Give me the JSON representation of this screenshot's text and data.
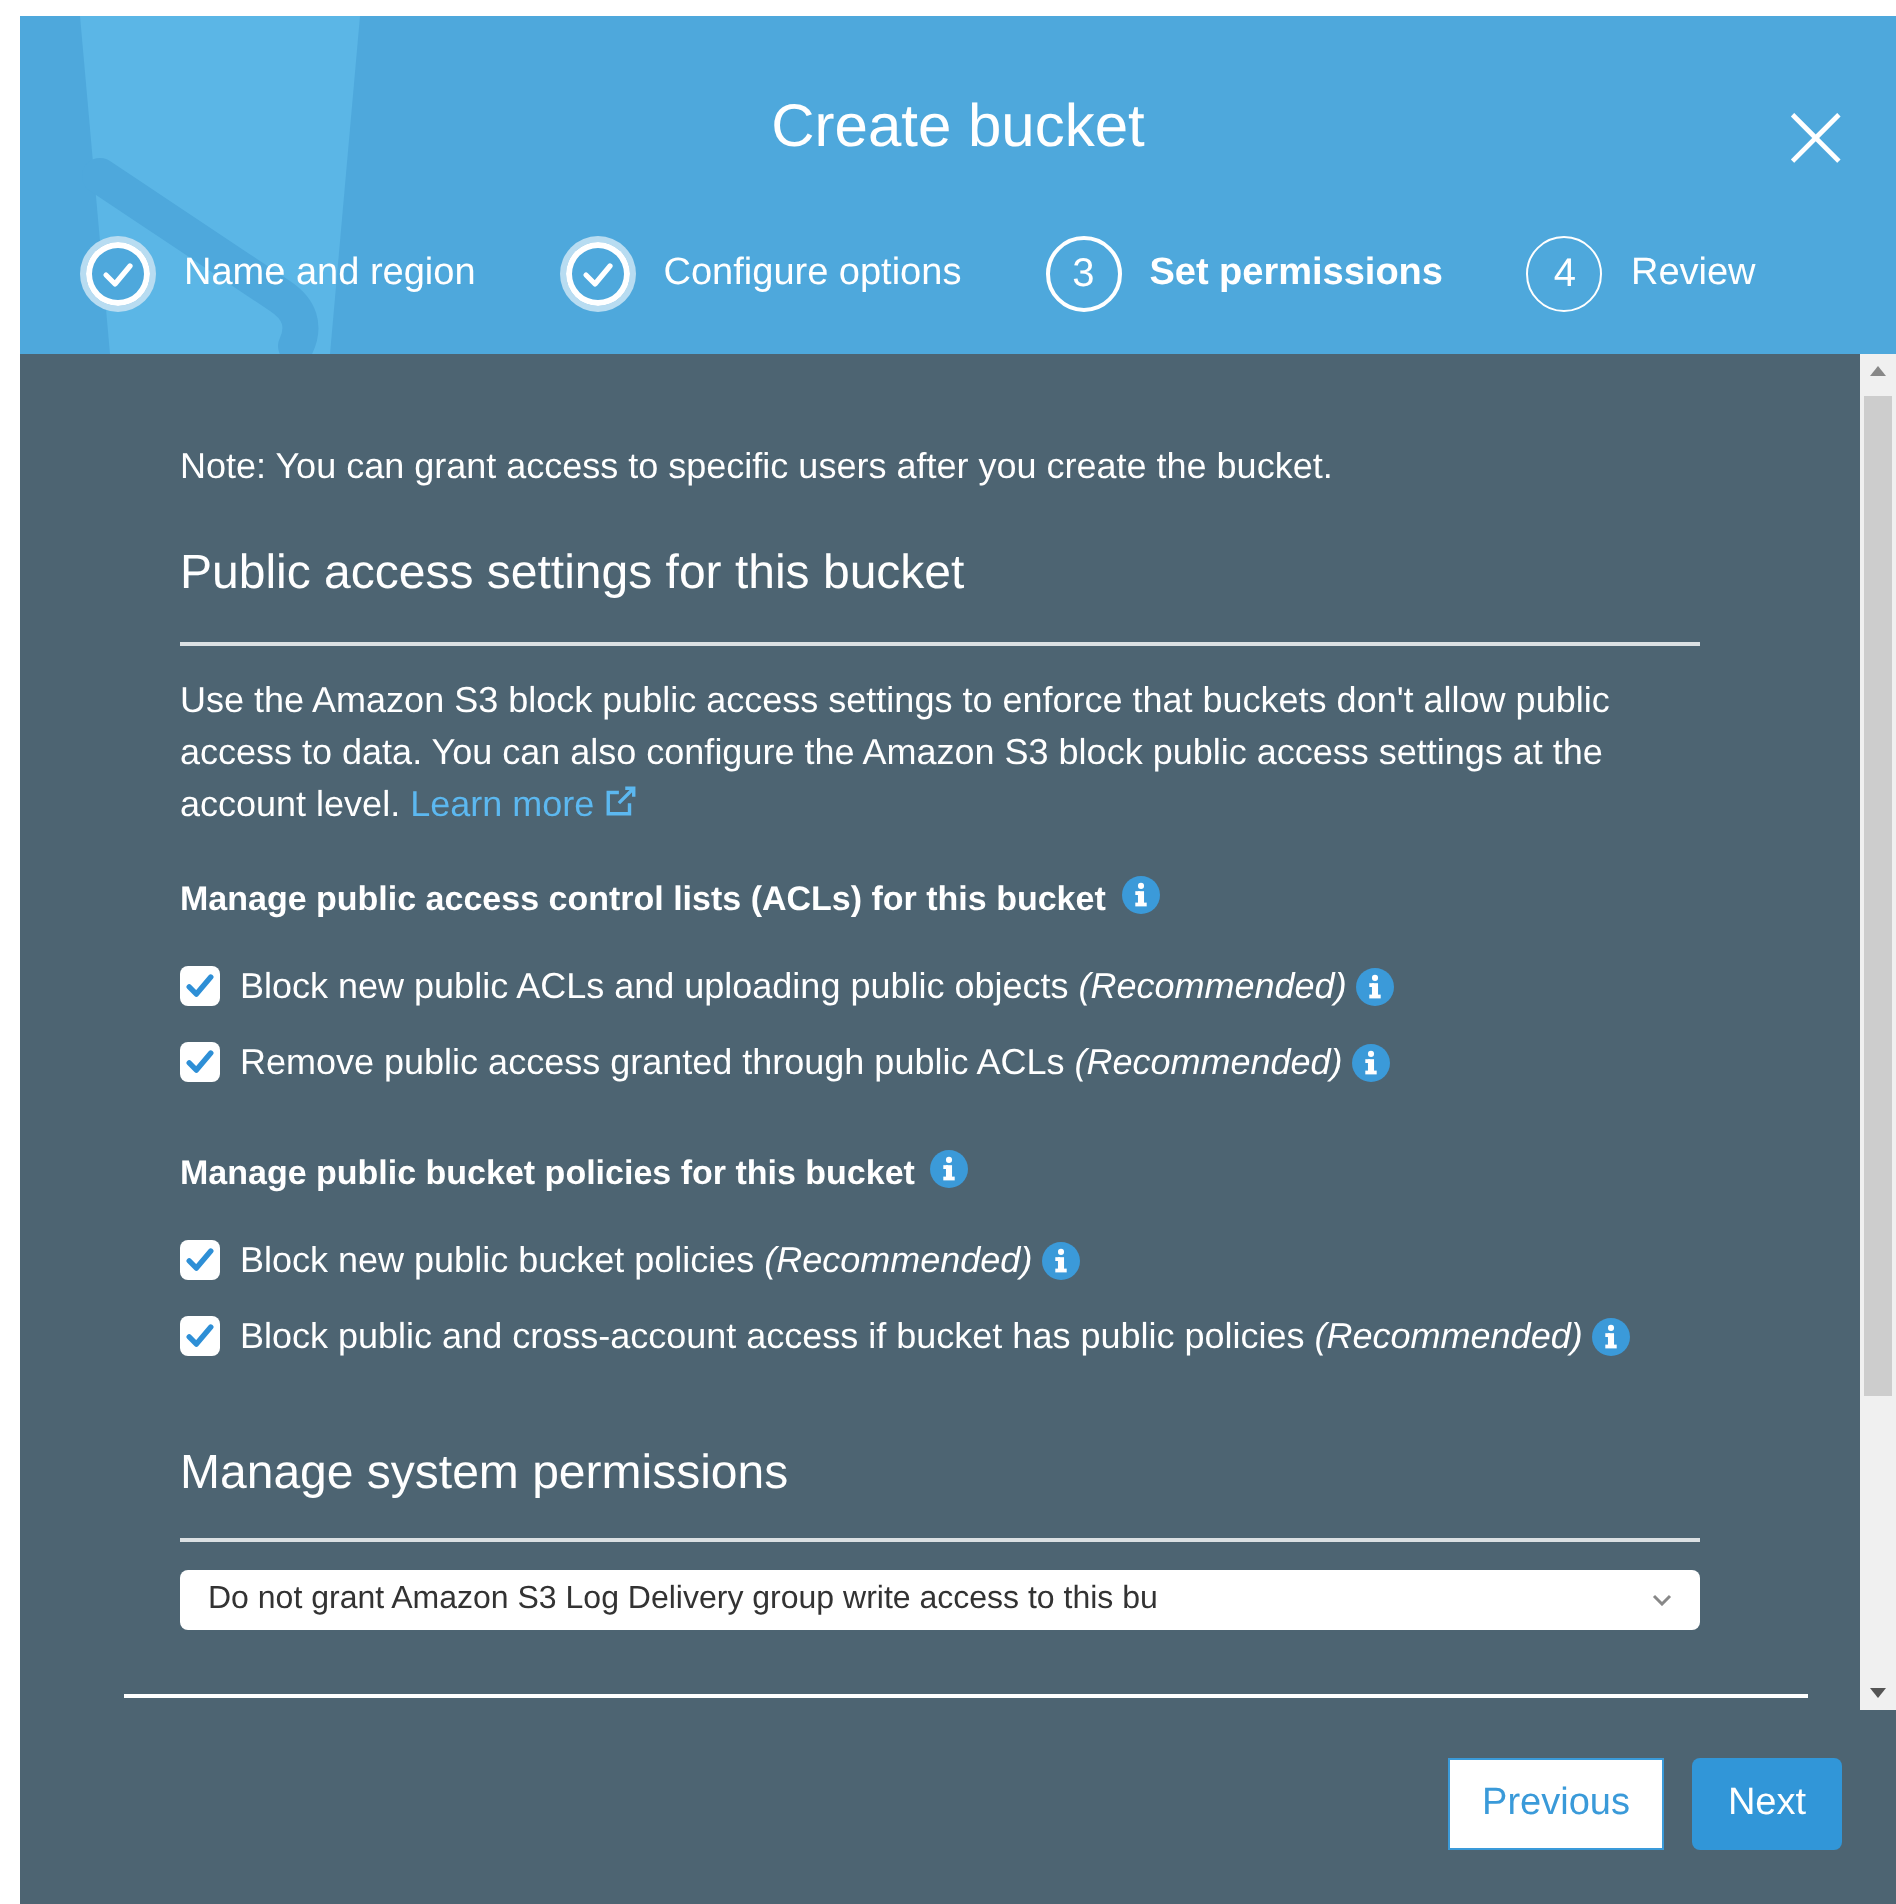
{
  "dialog": {
    "title": "Create bucket",
    "close": "×"
  },
  "steps": [
    {
      "label": "Name and region",
      "completed": true,
      "selected": false
    },
    {
      "label": "Configure options",
      "completed": true,
      "selected": false
    },
    {
      "label": "Set permissions",
      "number": "3",
      "completed": false,
      "selected": true
    },
    {
      "label": "Review",
      "number": "4",
      "completed": false,
      "selected": false
    }
  ],
  "note": "Note: You can grant access to specific users after you create the bucket.",
  "public_access": {
    "heading": "Public access settings for this bucket",
    "description": "Use the Amazon S3 block public access settings to enforce that buckets don't allow public access to data. You can also configure the Amazon S3 block public access settings at the account level.",
    "link": "Learn more",
    "groups": [
      {
        "title": "Manage public access control lists (ACLs) for this bucket",
        "options": [
          {
            "label": "Block new public ACLs and uploading public objects *(Recommended)*",
            "checked": true
          },
          {
            "label": "Remove public access granted through public ACLs *(Recommended)*",
            "checked": true
          }
        ]
      },
      {
        "title": "Manage public bucket policies for this bucket",
        "options": [
          {
            "label": "Block new public bucket policies *(Recommended)*",
            "checked": true
          },
          {
            "label": "Block public and cross-account access if bucket has public policies *(Recommended)*",
            "checked": true
          }
        ]
      }
    ]
  },
  "system_permissions": {
    "heading": "Manage system permissions",
    "dropdown": "Do not grant Amazon S3 Log Delivery group write access to this bu"
  },
  "buttons": {
    "previous": "Previous",
    "next": "Next"
  }
}
